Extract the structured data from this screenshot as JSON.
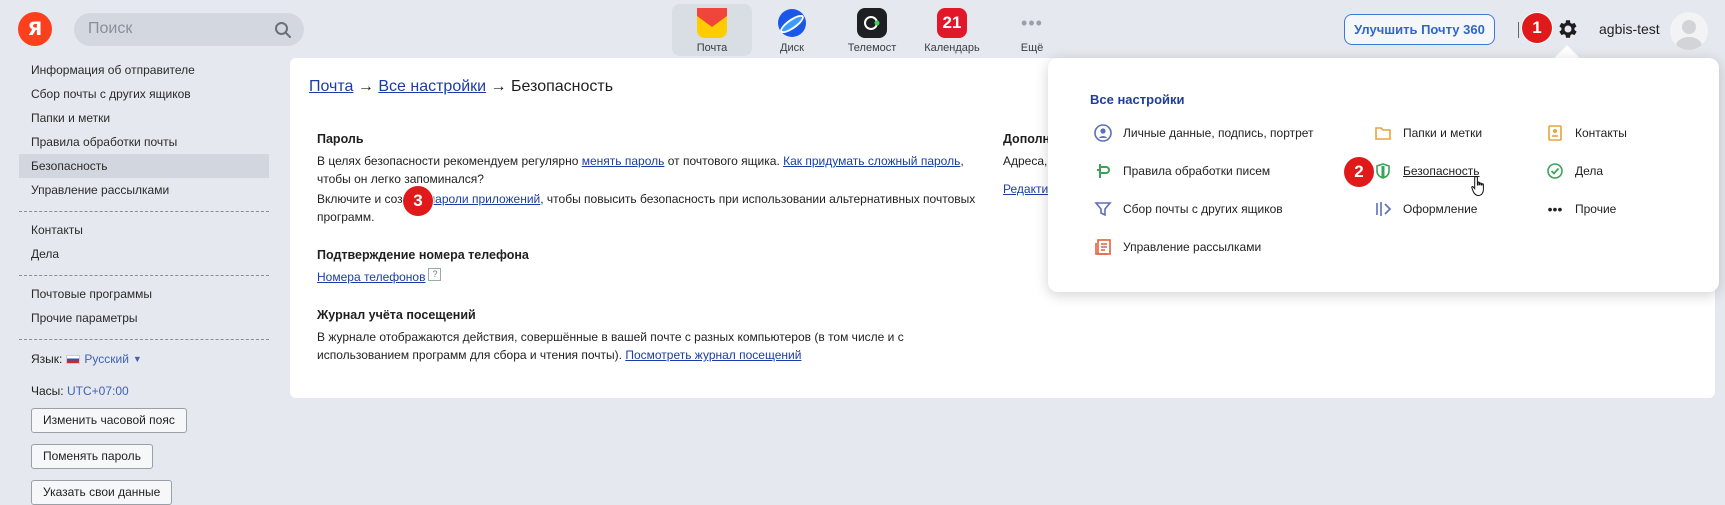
{
  "topbar": {
    "logo": "Я",
    "search_placeholder": "Поиск",
    "apps": [
      {
        "label": "Почта",
        "active": true,
        "icon": "mail-icon"
      },
      {
        "label": "Диск",
        "icon": "disk-icon"
      },
      {
        "label": "Телемост",
        "icon": "telemost-icon"
      },
      {
        "label": "Календарь",
        "icon": "calendar-icon",
        "badge": "21"
      },
      {
        "label": "Ещё",
        "icon": "more-icon"
      }
    ],
    "upgrade_label": "Улучшить Почту 360",
    "username": "agbis-test"
  },
  "annotations": [
    "1",
    "2",
    "3"
  ],
  "sidebar": {
    "group1": [
      {
        "label": "Информация об отправителе"
      },
      {
        "label": "Сбор почты с других ящиков"
      },
      {
        "label": "Папки и метки"
      },
      {
        "label": "Правила обработки почты"
      },
      {
        "label": "Безопасность",
        "selected": true
      },
      {
        "label": "Управление рассылками"
      }
    ],
    "group2": [
      {
        "label": "Контакты"
      },
      {
        "label": "Дела"
      }
    ],
    "group3": [
      {
        "label": "Почтовые программы"
      },
      {
        "label": "Прочие параметры"
      }
    ],
    "lang_label": "Язык:",
    "lang_value": "Русский",
    "tz_label": "Часы:",
    "tz_value": "UTC+07:00",
    "buttons": [
      "Изменить часовой пояс",
      "Поменять пароль",
      "Указать свои данные"
    ]
  },
  "main": {
    "breadcrumb": {
      "mail": "Почта",
      "arrow": "→",
      "all": "Все настройки",
      "current": "Безопасность"
    },
    "password": {
      "title": "Пароль",
      "p1_a": "В целях безопасности рекомендуем регулярно ",
      "p1_link1": "менять пароль",
      "p1_b": " от почтового ящика. ",
      "p1_link2": "Как придумать сложный пароль",
      "p1_c": ", чтобы он легко запоминался?",
      "p2_a": "Включите и соз",
      "p2_link": "пароли приложений",
      "p2_b": ", чтобы повысить безопасность при использовании альтернативных почтовых программ."
    },
    "phone": {
      "title": "Подтверждение номера телефона",
      "link": "Номера телефонов",
      "help": "?"
    },
    "journal": {
      "title": "Журнал учёта посещений",
      "text": "В журнале отображаются действия, совершённые в вашей почте с разных компьютеров (в том числе и с использованием программ для сбора и чтения почты). ",
      "link": "Посмотреть журнал посещений"
    },
    "right": {
      "title": "Дополн",
      "text": "Адреса,",
      "link": "Редакти"
    }
  },
  "popup": {
    "title": "Все настройки",
    "col1": [
      {
        "label": "Личные данные, подпись, портрет",
        "icon": "person-icon"
      },
      {
        "label": "Правила обработки писем",
        "icon": "rules-icon"
      },
      {
        "label": "Сбор почты с других ящиков",
        "icon": "filter-icon"
      },
      {
        "label": "Управление рассылками",
        "icon": "newsletter-icon"
      }
    ],
    "col2": [
      {
        "label": "Папки и метки",
        "icon": "folder-icon"
      },
      {
        "label": "Безопасность",
        "icon": "shield-icon"
      },
      {
        "label": "Оформление",
        "icon": "theme-icon"
      }
    ],
    "col3": [
      {
        "label": "Контакты",
        "icon": "contacts-icon"
      },
      {
        "label": "Дела",
        "icon": "check-icon"
      },
      {
        "label": "Прочие",
        "icon": "dots-icon"
      }
    ]
  },
  "colors": {
    "accent": "#3f78db",
    "badge": "#e01a1a",
    "logo": "#fc3f1d"
  }
}
